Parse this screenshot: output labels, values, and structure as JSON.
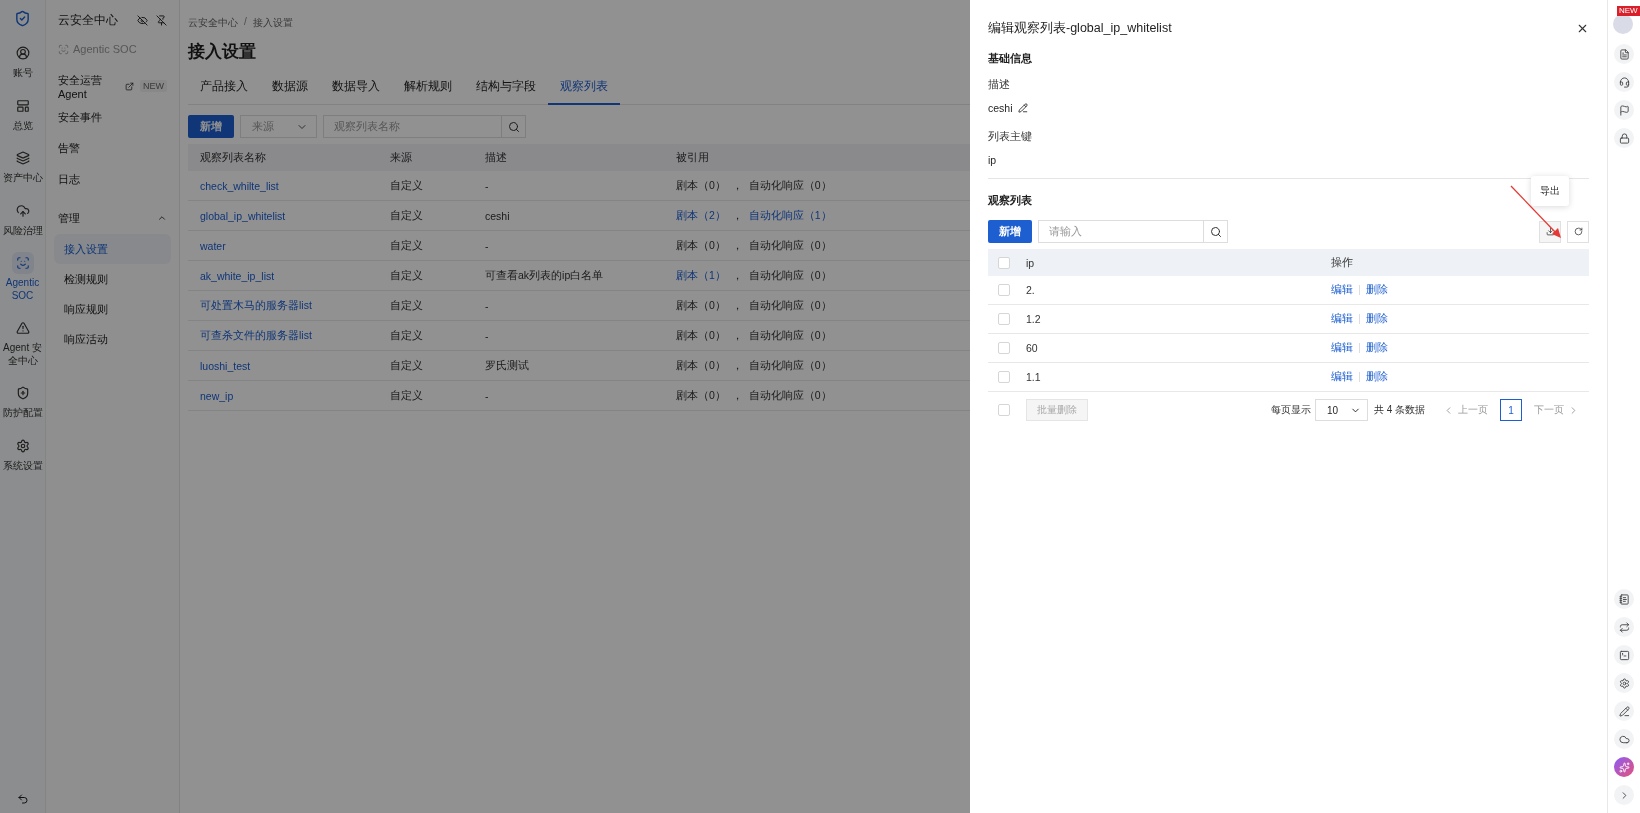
{
  "rail": {
    "items": [
      {
        "label": "账号",
        "selected": false
      },
      {
        "label": "总览",
        "selected": false
      },
      {
        "label": "资产中心",
        "selected": false
      },
      {
        "label": "风险治理",
        "selected": false
      },
      {
        "label": "Agentic SOC",
        "selected": true
      },
      {
        "label": "Agent 安全中心",
        "selected": false
      },
      {
        "label": "防护配置",
        "selected": false
      },
      {
        "label": "系统设置",
        "selected": false
      }
    ]
  },
  "nav": {
    "title": "云安全中心",
    "subtitle": "Agentic SOC",
    "items": [
      {
        "label": "安全运营 Agent",
        "badge": "NEW",
        "external": true,
        "selected": false
      },
      {
        "label": "安全事件",
        "selected": false
      },
      {
        "label": "告警",
        "selected": false
      },
      {
        "label": "日志",
        "selected": false
      },
      {
        "label": "管理",
        "expanded": true,
        "selected": false,
        "children": [
          {
            "label": "接入设置",
            "selected": true
          },
          {
            "label": "检测规则",
            "selected": false
          },
          {
            "label": "响应规则",
            "selected": false
          },
          {
            "label": "响应活动",
            "selected": false
          }
        ]
      }
    ]
  },
  "breadcrumb": [
    "云安全中心",
    "接入设置"
  ],
  "breadcrumb_separator": "/",
  "page_title": "接入设置",
  "tabs": [
    {
      "label": "产品接入",
      "selected": false
    },
    {
      "label": "数据源",
      "selected": false
    },
    {
      "label": "数据导入",
      "selected": false
    },
    {
      "label": "解析规则",
      "selected": false
    },
    {
      "label": "结构与字段",
      "selected": false
    },
    {
      "label": "观察列表",
      "selected": true
    }
  ],
  "toolbar": {
    "add_button": "新增",
    "source_select": {
      "placeholder": "来源"
    },
    "search": {
      "placeholder": "观察列表名称"
    }
  },
  "table": {
    "columns": [
      "观察列表名称",
      "来源",
      "描述",
      "被引用"
    ],
    "rows": [
      {
        "name": "check_whilte_list",
        "source": "自定义",
        "description": "-",
        "script": {
          "text": "剧本（0）",
          "linked": false
        },
        "separator": "，",
        "auto": {
          "text": "自动化响应（0）",
          "linked": false
        }
      },
      {
        "name": "global_ip_whitelist",
        "source": "自定义",
        "description": "ceshi",
        "script": {
          "text": "剧本（2）",
          "linked": true
        },
        "separator": "，",
        "auto": {
          "text": "自动化响应（1）",
          "linked": true
        }
      },
      {
        "name": "water",
        "source": "自定义",
        "description": "-",
        "script": {
          "text": "剧本（0）",
          "linked": false
        },
        "separator": "，",
        "auto": {
          "text": "自动化响应（0）",
          "linked": false
        }
      },
      {
        "name": "ak_white_ip_list",
        "source": "自定义",
        "description": "可查看ak列表的ip白名单",
        "script": {
          "text": "剧本（1）",
          "linked": true
        },
        "separator": "，",
        "auto": {
          "text": "自动化响应（0）",
          "linked": false
        }
      },
      {
        "name": "可处置木马的服务器list",
        "source": "自定义",
        "description": "-",
        "script": {
          "text": "剧本（0）",
          "linked": false
        },
        "separator": "，",
        "auto": {
          "text": "自动化响应（0）",
          "linked": false
        }
      },
      {
        "name": "可查杀文件的服务器list",
        "source": "自定义",
        "description": "-",
        "script": {
          "text": "剧本（0）",
          "linked": false
        },
        "separator": "，",
        "auto": {
          "text": "自动化响应（0）",
          "linked": false
        }
      },
      {
        "name": "luoshi_test",
        "source": "自定义",
        "description": "罗氏测试",
        "script": {
          "text": "剧本（0）",
          "linked": false
        },
        "separator": "，",
        "auto": {
          "text": "自动化响应（0）",
          "linked": false
        }
      },
      {
        "name": "new_ip",
        "source": "自定义",
        "description": "-",
        "script": {
          "text": "剧本（0）",
          "linked": false
        },
        "separator": "，",
        "auto": {
          "text": "自动化响应（0）",
          "linked": false
        }
      }
    ]
  },
  "drawer": {
    "title": "编辑观察列表-global_ip_whitelist",
    "section_basic": "基础信息",
    "description_label": "描述",
    "description_value": "ceshi",
    "key_label": "列表主键",
    "key_value": "ip",
    "section_list": "观察列表",
    "add_button": "新增",
    "search": {
      "placeholder": "请输入"
    },
    "export_tooltip": "导出",
    "columns": [
      "ip",
      "操作"
    ],
    "rows": [
      {
        "ip": "2.",
        "checked": false,
        "actions": [
          "编辑",
          "删除"
        ]
      },
      {
        "ip": "1.2",
        "checked": false,
        "actions": [
          "编辑",
          "删除"
        ]
      },
      {
        "ip": "60",
        "checked": false,
        "actions": [
          "编辑",
          "删除"
        ]
      },
      {
        "ip": "1.1",
        "checked": false,
        "actions": [
          "编辑",
          "删除"
        ]
      }
    ],
    "select_all_checked": false,
    "batch_delete": {
      "label": "批量删除",
      "disabled": true
    },
    "page_size_label": "每页显示",
    "page_size": "10",
    "total": "共 4 条数据",
    "prev": "上一页",
    "next": "下一页",
    "pages": [
      {
        "label": "1",
        "selected": true
      }
    ]
  },
  "right_rail": {
    "badge": "NEW"
  }
}
